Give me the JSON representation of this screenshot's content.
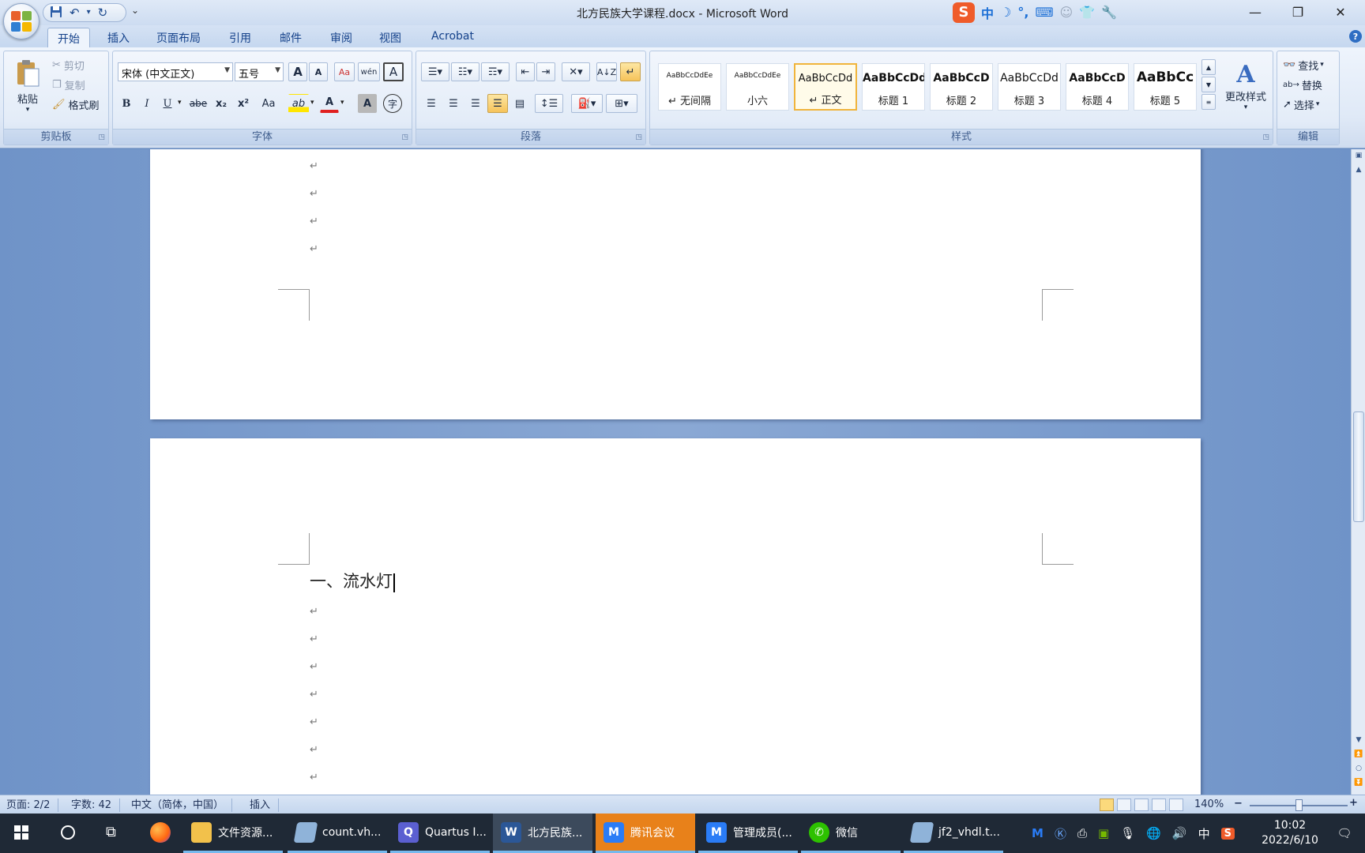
{
  "window": {
    "title": "北方民族大学课程.docx - Microsoft Word",
    "minimize_glyph": "—",
    "restore_glyph": "❐",
    "close_glyph": "✕"
  },
  "qat": {
    "more_glyph": "⌄"
  },
  "ime": {
    "logo": "S",
    "mode": "中",
    "glyphs": [
      "☽",
      "°,",
      "⌨",
      "☺",
      "👕",
      "🔧"
    ]
  },
  "tabs": [
    "开始",
    "插入",
    "页面布局",
    "引用",
    "邮件",
    "审阅",
    "视图",
    "Acrobat"
  ],
  "clipboard": {
    "paste": "粘贴",
    "cut": "剪切",
    "copy": "复制",
    "format_painter": "格式刷",
    "group_label": "剪贴板"
  },
  "font": {
    "name": "宋体 (中文正文)",
    "size": "五号",
    "grow": "A",
    "shrink": "A",
    "clear": "Aa",
    "phonetic": "wén",
    "border_char": "A",
    "bold": "B",
    "italic": "I",
    "underline": "U",
    "strike": "abe",
    "subscript": "x₂",
    "superscript": "x²",
    "case": "Aa",
    "highlight": "ab",
    "color": "A",
    "shade": "A",
    "enclose": "字",
    "group_label": "字体"
  },
  "paragraph": {
    "group_label": "段落"
  },
  "styles": {
    "items": [
      {
        "sample": "AaBbCcDdEe",
        "name": "↵ 无间隔"
      },
      {
        "sample": "AaBbCcDdEe",
        "name": "小六"
      },
      {
        "sample": "AaBbCcDd",
        "name": "↵ 正文"
      },
      {
        "sample": "AaBbCcDd",
        "name": "标题 1"
      },
      {
        "sample": "AaBbCcD",
        "name": "标题 2"
      },
      {
        "sample": "AaBbCcDd",
        "name": "标题 3"
      },
      {
        "sample": "AaBbCcD",
        "name": "标题 4"
      },
      {
        "sample": "AaBbCc",
        "name": "标题 5"
      }
    ],
    "change_styles": "更改样式",
    "group_label": "样式"
  },
  "editing": {
    "find": "查找",
    "replace": "替换",
    "select": "选择",
    "group_label": "编辑"
  },
  "document": {
    "paragraph_mark": "↵",
    "heading": "一、流水灯"
  },
  "status": {
    "page": "页面: 2/2",
    "words": "字数: 42",
    "language": "中文（简体，中国）",
    "mode": "插入",
    "zoom": "140%",
    "zoom_minus": "−",
    "zoom_plus": "+"
  },
  "taskbar": {
    "items": [
      {
        "label": "文件资源...",
        "color": "#f2c14b"
      },
      {
        "label": "count.vh...",
        "color": "#8fb3d9"
      },
      {
        "label": "Quartus I...",
        "color": "#5b5fd1"
      },
      {
        "label": "北方民族...",
        "color": "#2b5797"
      },
      {
        "label": "腾讯会议",
        "color": "#2a7cf6"
      },
      {
        "label": "管理成员(...",
        "color": "#2a7cf6"
      },
      {
        "label": "微信",
        "color": "#2dc100"
      },
      {
        "label": "jf2_vhdl.t...",
        "color": "#8fb3d9"
      }
    ],
    "ime_mode": "中",
    "time": "10:02",
    "date": "2022/6/10"
  }
}
